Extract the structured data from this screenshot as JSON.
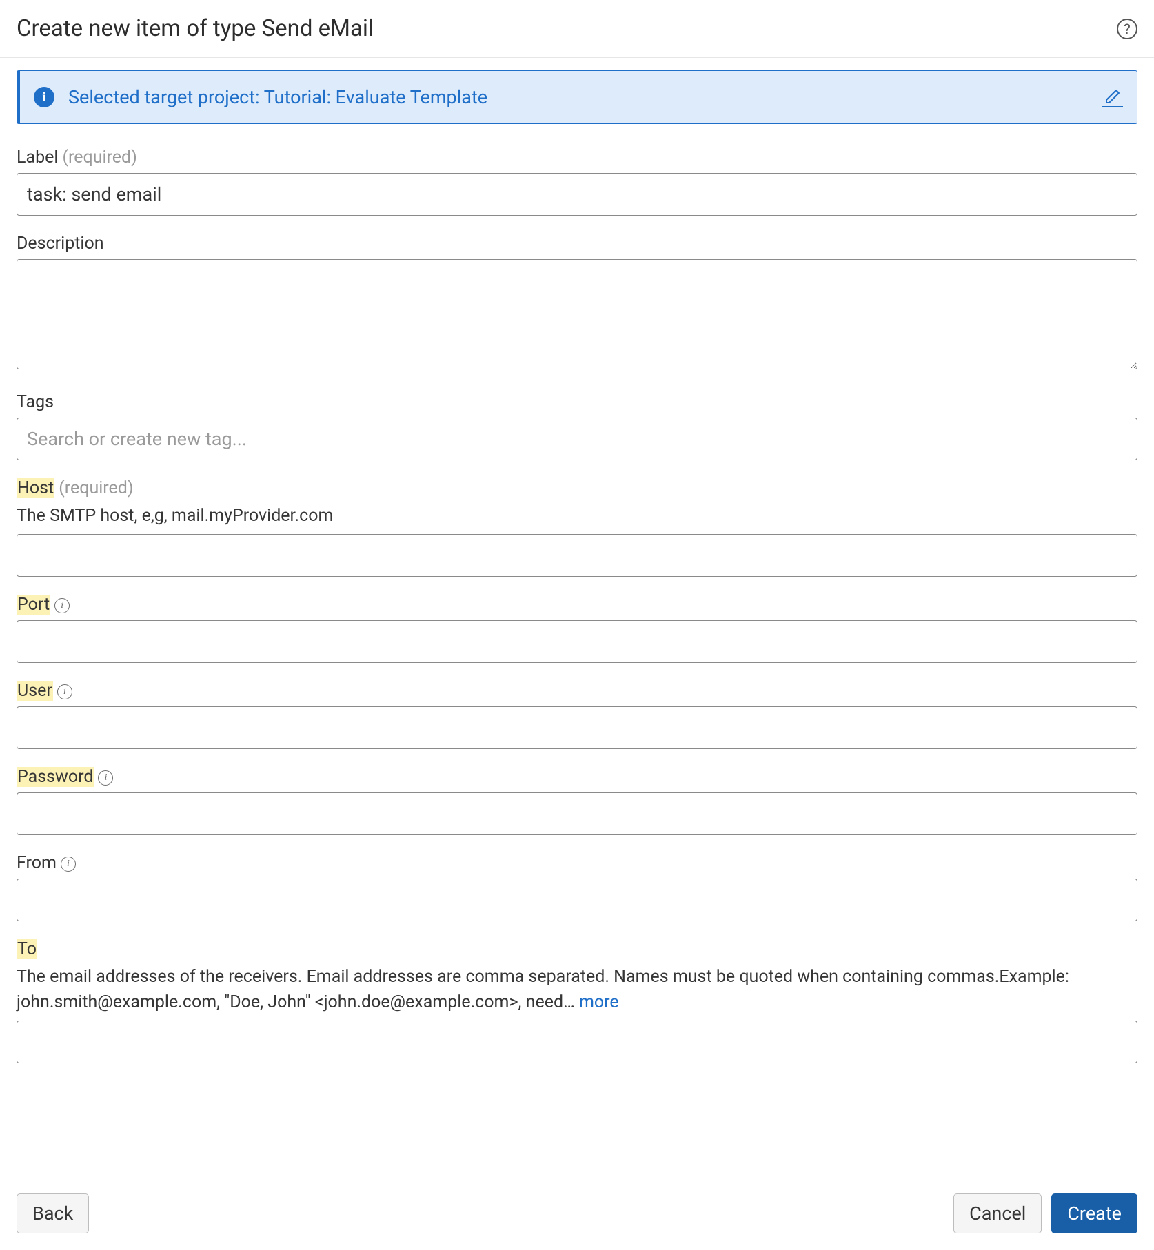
{
  "header": {
    "title": "Create new item of type Send eMail"
  },
  "banner": {
    "text": "Selected target project: Tutorial: Evaluate Template"
  },
  "fields": {
    "label": {
      "label": "Label",
      "required_hint": "(required)",
      "value": "task: send email"
    },
    "description": {
      "label": "Description",
      "value": ""
    },
    "tags": {
      "label": "Tags",
      "placeholder": "Search or create new tag...",
      "value": ""
    },
    "host": {
      "label": "Host",
      "required_hint": "(required)",
      "help": "The SMTP host, e,g, mail.myProvider.com",
      "value": ""
    },
    "port": {
      "label": "Port",
      "value": ""
    },
    "user": {
      "label": "User",
      "value": ""
    },
    "password": {
      "label": "Password",
      "value": ""
    },
    "from": {
      "label": "From",
      "value": ""
    },
    "to": {
      "label": "To",
      "help": "The email addresses of the receivers. Email addresses are comma separated. Names must be quoted when containing commas.Example: john.smith@example.com, \"Doe, John\" <john.doe@example.com>, need…",
      "more": " more",
      "value": ""
    }
  },
  "footer": {
    "back": "Back",
    "cancel": "Cancel",
    "create": "Create"
  }
}
